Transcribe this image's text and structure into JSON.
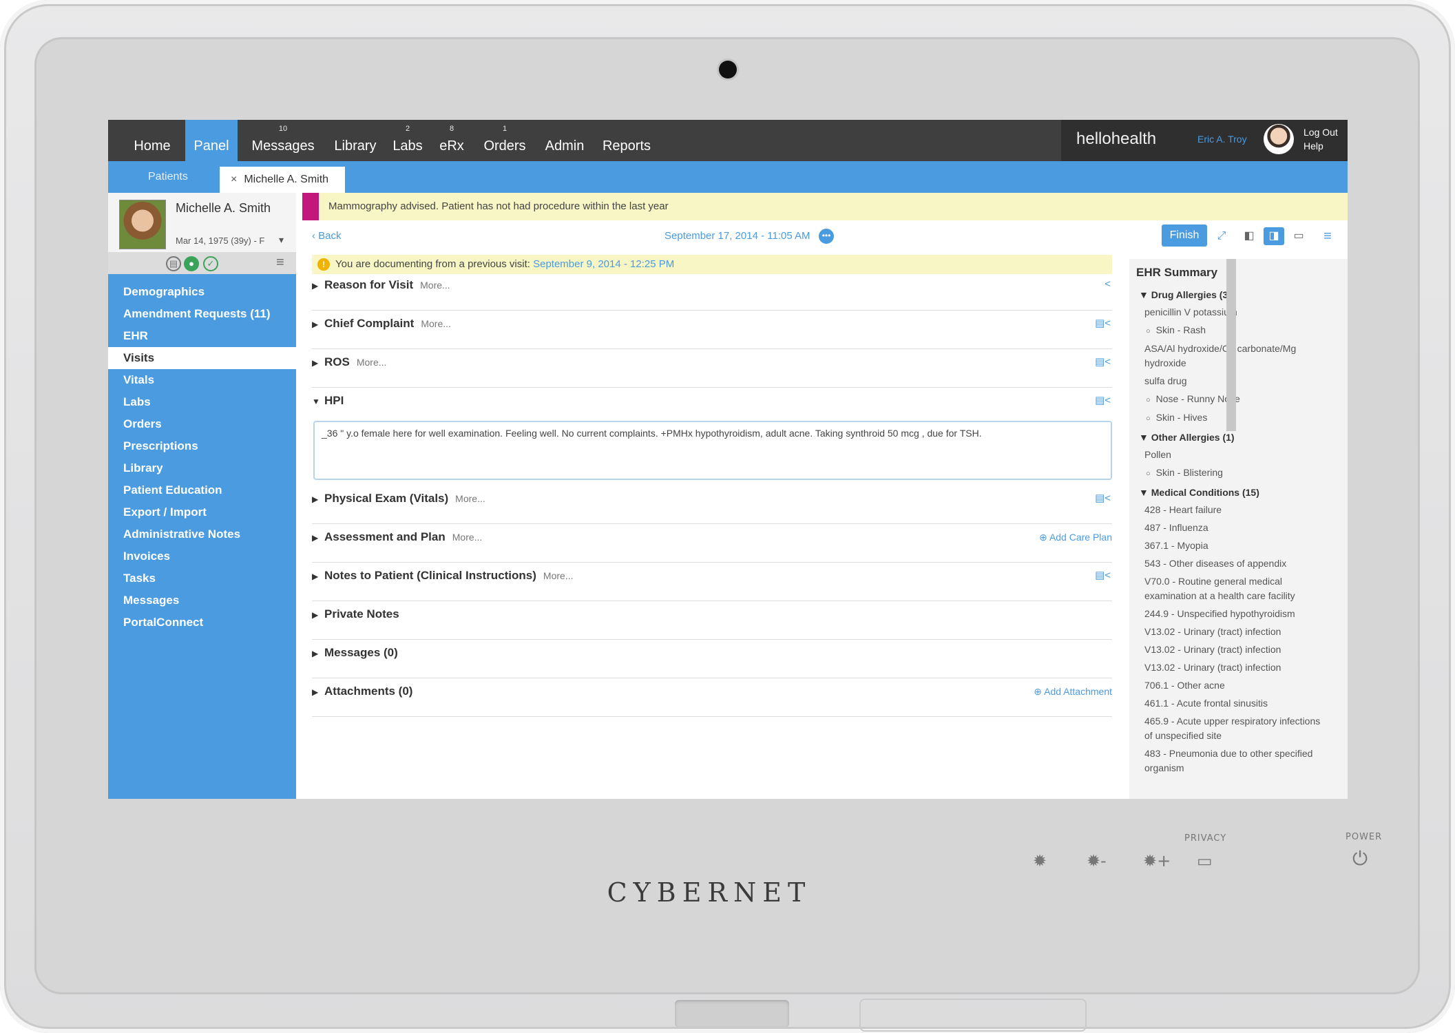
{
  "device": {
    "brand": "CYBERNET",
    "privacy_label": "PRIVACY",
    "power_label": "POWER"
  },
  "topnav": {
    "items": [
      {
        "label": "Home",
        "badge": ""
      },
      {
        "label": "Panel",
        "badge": ""
      },
      {
        "label": "Messages",
        "badge": "10"
      },
      {
        "label": "Library",
        "badge": ""
      },
      {
        "label": "Labs",
        "badge": "2"
      },
      {
        "label": "eRx",
        "badge": "8"
      },
      {
        "label": "Orders",
        "badge": "1"
      },
      {
        "label": "Admin",
        "badge": ""
      },
      {
        "label": "Reports",
        "badge": ""
      }
    ],
    "logo": "hellohealth",
    "user": "Eric A. Troy",
    "logout": "Log Out",
    "help": "Help"
  },
  "tabs": {
    "patients": "Patients",
    "close": "×",
    "patient": "Michelle A. Smith"
  },
  "patient": {
    "name": "Michelle A. Smith",
    "dob": "Mar 14, 1975 (39y) - F"
  },
  "sidebar": {
    "items": [
      {
        "label": "Demographics"
      },
      {
        "label": "Amendment Requests (11)"
      },
      {
        "label": "EHR"
      },
      {
        "label": "Visits"
      },
      {
        "label": "Vitals"
      },
      {
        "label": "Labs"
      },
      {
        "label": "Orders"
      },
      {
        "label": "Prescriptions"
      },
      {
        "label": "Library"
      },
      {
        "label": "Patient Education"
      },
      {
        "label": "Export / Import"
      },
      {
        "label": "Administrative Notes"
      },
      {
        "label": "Invoices"
      },
      {
        "label": "Tasks"
      },
      {
        "label": "Messages"
      },
      {
        "label": "PortalConnect"
      }
    ]
  },
  "alert": {
    "text": "Mammography advised. Patient has not had procedure within the last year"
  },
  "visit": {
    "back": "Back",
    "date": "September 17, 2014 - 11:05 AM",
    "finish": "Finish",
    "prev_text": "You are documenting from a previous visit: ",
    "prev_link": "September 9, 2014 - 12:25 PM"
  },
  "sections": [
    {
      "title": "Reason for Visit",
      "more": "More..."
    },
    {
      "title": "Chief Complaint",
      "more": "More..."
    },
    {
      "title": "ROS",
      "more": "More..."
    },
    {
      "title": "HPI",
      "more": ""
    },
    {
      "title": "Physical Exam (Vitals)",
      "more": "More..."
    },
    {
      "title": "Assessment and Plan",
      "more": "More...",
      "action": "Add Care Plan"
    },
    {
      "title": "Notes to Patient (Clinical Instructions)",
      "more": "More..."
    },
    {
      "title": "Private Notes",
      "more": ""
    },
    {
      "title": "Messages (0)",
      "more": ""
    },
    {
      "title": "Attachments (0)",
      "more": "",
      "action": "Add Attachment"
    }
  ],
  "hpi": {
    "text": "_36 \" y.o female here for well examination. Feeling well.  No current complaints. +PMHx hypothyroidism, adult acne. Taking synthroid 50 mcg , due for TSH."
  },
  "ehr": {
    "title": "EHR Summary",
    "drug_allergies": "Drug Allergies (3)",
    "da": [
      "penicillin V potassium",
      "Skin - Rash",
      "ASA/Al hydroxide/Ca carbonate/Mg hydroxide",
      "sulfa drug",
      "Nose - Runny Nose",
      "Skin - Hives"
    ],
    "other_allergies": "Other Allergies (1)",
    "oa": [
      "Pollen",
      "Skin - Blistering"
    ],
    "medical_conditions": "Medical Conditions (15)",
    "mc": [
      "428 - Heart failure",
      "487 - Influenza",
      "367.1 - Myopia",
      "543 - Other diseases of appendix",
      "V70.0 - Routine general medical examination at a health care facility",
      "244.9 - Unspecified hypothyroidism",
      "V13.02 - Urinary (tract) infection",
      "V13.02 - Urinary (tract) infection",
      "V13.02 - Urinary (tract) infection",
      "706.1 - Other acne",
      "461.1 - Acute frontal sinusitis",
      "465.9 - Acute upper respiratory infections of unspecified site",
      "483 - Pneumonia due to other specified organism"
    ]
  },
  "colors": {
    "accent": "#4a9be0",
    "nav_bg": "#3f3f3f",
    "alert_bg": "#f7f6c4",
    "alert_mark": "#c2187b"
  }
}
